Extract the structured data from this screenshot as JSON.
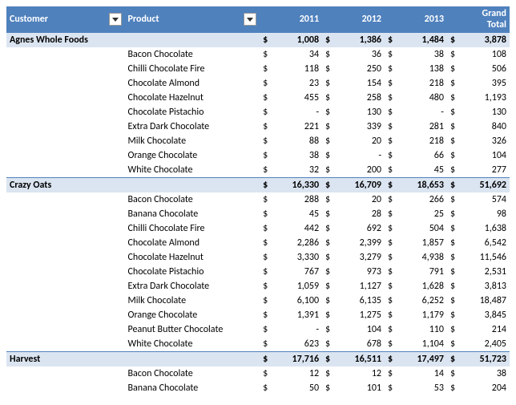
{
  "header": {
    "customer": "Customer",
    "product": "Product",
    "y2011": "2011",
    "y2012": "2012",
    "y2013": "2013",
    "grand_total": "Grand Total"
  },
  "chart_data": {
    "type": "table",
    "columns": [
      "Customer",
      "Product",
      "2011",
      "2012",
      "2013",
      "Grand Total"
    ],
    "groups": [
      {
        "customer": "Agnes Whole Foods",
        "subtotal": {
          "y2011": "1,008",
          "y2012": "1,386",
          "y2013": "1,484",
          "total": "3,878"
        },
        "rows": [
          {
            "product": "Bacon Chocolate",
            "y2011": "34",
            "y2012": "36",
            "y2013": "38",
            "total": "108"
          },
          {
            "product": "Chilli Chocolate Fire",
            "y2011": "118",
            "y2012": "250",
            "y2013": "138",
            "total": "506"
          },
          {
            "product": "Chocolate Almond",
            "y2011": "23",
            "y2012": "154",
            "y2013": "218",
            "total": "395"
          },
          {
            "product": "Chocolate Hazelnut",
            "y2011": "455",
            "y2012": "258",
            "y2013": "480",
            "total": "1,193"
          },
          {
            "product": "Chocolate Pistachio",
            "y2011": "-",
            "y2012": "130",
            "y2013": "-",
            "total": "130"
          },
          {
            "product": "Extra Dark Chocolate",
            "y2011": "221",
            "y2012": "339",
            "y2013": "281",
            "total": "840"
          },
          {
            "product": "Milk Chocolate",
            "y2011": "88",
            "y2012": "20",
            "y2013": "218",
            "total": "326"
          },
          {
            "product": "Orange Chocolate",
            "y2011": "38",
            "y2012": "-",
            "y2013": "66",
            "total": "104"
          },
          {
            "product": "White Chocolate",
            "y2011": "32",
            "y2012": "200",
            "y2013": "45",
            "total": "277"
          }
        ]
      },
      {
        "customer": "Crazy Oats",
        "subtotal": {
          "y2011": "16,330",
          "y2012": "16,709",
          "y2013": "18,653",
          "total": "51,692"
        },
        "rows": [
          {
            "product": "Bacon Chocolate",
            "y2011": "288",
            "y2012": "20",
            "y2013": "266",
            "total": "574"
          },
          {
            "product": "Banana Chocolate",
            "y2011": "45",
            "y2012": "28",
            "y2013": "25",
            "total": "98"
          },
          {
            "product": "Chilli Chocolate Fire",
            "y2011": "442",
            "y2012": "692",
            "y2013": "504",
            "total": "1,638"
          },
          {
            "product": "Chocolate Almond",
            "y2011": "2,286",
            "y2012": "2,399",
            "y2013": "1,857",
            "total": "6,542"
          },
          {
            "product": "Chocolate Hazelnut",
            "y2011": "3,330",
            "y2012": "3,279",
            "y2013": "4,938",
            "total": "11,546"
          },
          {
            "product": "Chocolate Pistachio",
            "y2011": "767",
            "y2012": "973",
            "y2013": "791",
            "total": "2,531"
          },
          {
            "product": "Extra Dark Chocolate",
            "y2011": "1,059",
            "y2012": "1,127",
            "y2013": "1,628",
            "total": "3,813"
          },
          {
            "product": "Milk Chocolate",
            "y2011": "6,100",
            "y2012": "6,135",
            "y2013": "6,252",
            "total": "18,487"
          },
          {
            "product": "Orange Chocolate",
            "y2011": "1,391",
            "y2012": "1,275",
            "y2013": "1,179",
            "total": "3,845"
          },
          {
            "product": "Peanut Butter Chocolate",
            "y2011": "-",
            "y2012": "104",
            "y2013": "110",
            "total": "214"
          },
          {
            "product": "White Chocolate",
            "y2011": "623",
            "y2012": "678",
            "y2013": "1,104",
            "total": "2,405"
          }
        ]
      },
      {
        "customer": "Harvest",
        "subtotal": {
          "y2011": "17,716",
          "y2012": "16,511",
          "y2013": "17,497",
          "total": "51,723"
        },
        "rows": [
          {
            "product": "Bacon Chocolate",
            "y2011": "12",
            "y2012": "12",
            "y2013": "14",
            "total": "38"
          },
          {
            "product": "Banana Chocolate",
            "y2011": "50",
            "y2012": "101",
            "y2013": "53",
            "total": "204"
          }
        ]
      }
    ]
  },
  "currency_symbol": "$"
}
